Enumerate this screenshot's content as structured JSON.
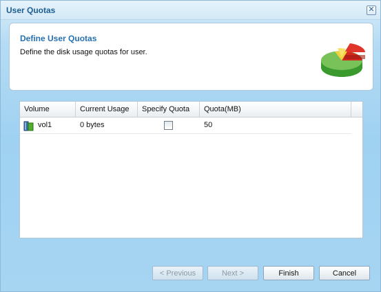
{
  "window": {
    "title": "User Quotas",
    "close_label": "✕"
  },
  "header": {
    "title": "Define User Quotas",
    "description": "Define the disk usage quotas for user."
  },
  "table": {
    "columns": [
      "Volume",
      "Current Usage",
      "Specify Quota",
      "Quota(MB)"
    ],
    "rows": [
      {
        "volume": "vol1",
        "current_usage": "0 bytes",
        "specify_quota": false,
        "quota_mb": "50"
      }
    ]
  },
  "buttons": {
    "previous": "< Previous",
    "next": "Next >",
    "finish": "Finish",
    "cancel": "Cancel"
  },
  "icons": {
    "pie": "pie-chart-icon",
    "volume": "volume-icon",
    "close": "close-icon"
  }
}
